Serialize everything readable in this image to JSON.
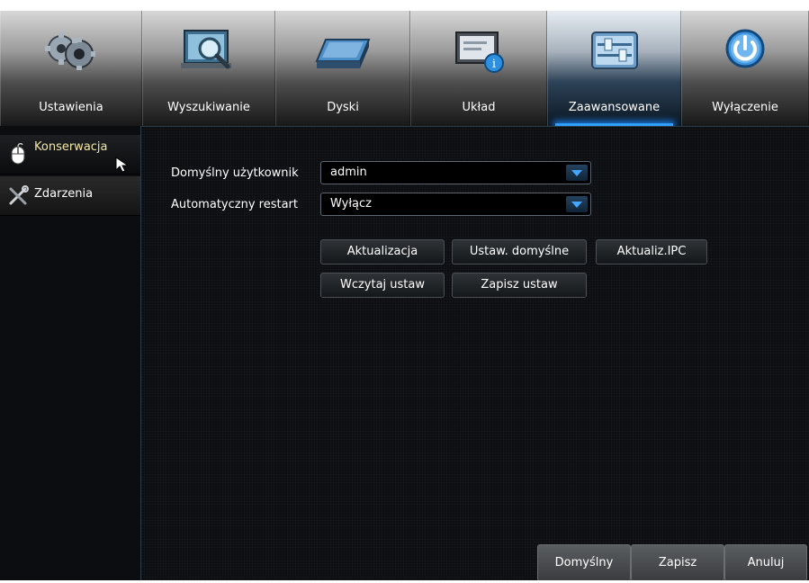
{
  "tabs": [
    {
      "label": "Ustawienia",
      "icon": "gears-icon"
    },
    {
      "label": "Wyszukiwanie",
      "icon": "search-icon"
    },
    {
      "label": "Dyski",
      "icon": "disk-icon"
    },
    {
      "label": "Układ",
      "icon": "system-info-icon"
    },
    {
      "label": "Zaawansowane",
      "icon": "sliders-icon",
      "active": true
    },
    {
      "label": "Wyłączenie",
      "icon": "power-icon"
    }
  ],
  "sidebar": {
    "items": [
      {
        "label": "Konserwacja",
        "icon": "mouse-icon",
        "active": true
      },
      {
        "label": "Zdarzenia",
        "icon": "tools-icon"
      }
    ]
  },
  "form": {
    "default_user_label": "Domyślny użytkownik",
    "default_user_value": "admin",
    "auto_restart_label": "Automatyczny restart",
    "auto_restart_value": "Wyłącz"
  },
  "buttons": {
    "update": "Aktualizacja",
    "set_defaults": "Ustaw. domyślne",
    "update_ipc": "Aktualiz.IPC",
    "load_settings": "Wczytaj ustaw",
    "save_settings": "Zapisz ustaw"
  },
  "footer": {
    "default": "Domyślny",
    "save": "Zapisz",
    "cancel": "Anuluj"
  },
  "colors": {
    "accent": "#2f9fff",
    "active_label": "#f2e7a6",
    "background": "#07090b"
  }
}
